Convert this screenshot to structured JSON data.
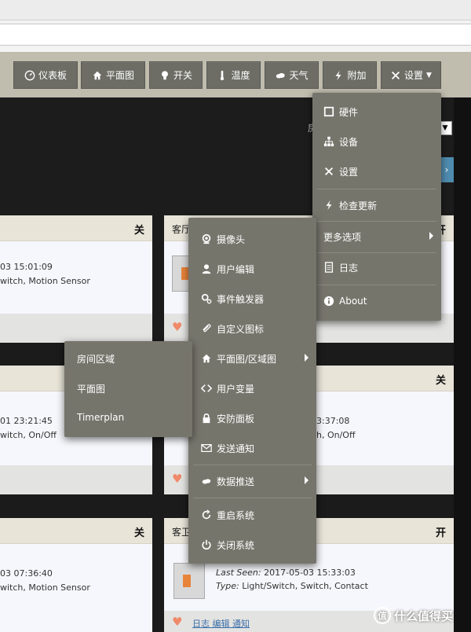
{
  "navbar": {
    "buttons": [
      {
        "label": "仪表板",
        "icon": "dashboard-icon"
      },
      {
        "label": "平面图",
        "icon": "home-icon"
      },
      {
        "label": "开关",
        "icon": "bulb-icon"
      },
      {
        "label": "温度",
        "icon": "thermometer-icon"
      },
      {
        "label": "天气",
        "icon": "cloud-icon"
      },
      {
        "label": "附加",
        "icon": "bolt-icon"
      },
      {
        "label": "设置",
        "icon": "wrench-icon"
      }
    ]
  },
  "header": {
    "partial_label": "房",
    "select_arrow": "▼",
    "next_arrow": "›"
  },
  "settings_menu": {
    "items": [
      {
        "label": "硬件",
        "icon": "hardware-icon"
      },
      {
        "label": "设备",
        "icon": "sitemap-icon"
      },
      {
        "label": "设置",
        "icon": "wrench-icon"
      },
      {
        "label": "检查更新",
        "icon": "bolt-icon"
      },
      {
        "label": "更多选项",
        "icon": ""
      },
      {
        "label": "日志",
        "icon": "log-icon"
      },
      {
        "label": "About",
        "icon": "info-icon"
      }
    ]
  },
  "more_menu": {
    "items": [
      {
        "label": "摄像头",
        "icon": "camera-icon"
      },
      {
        "label": "用户编辑",
        "icon": "user-icon"
      },
      {
        "label": "事件触发器",
        "icon": "gears-icon"
      },
      {
        "label": "自定义图标",
        "icon": "paperclip-icon"
      },
      {
        "label": "平面图/区域图",
        "icon": "home-icon"
      },
      {
        "label": "用户变量",
        "icon": "code-icon"
      },
      {
        "label": "安防面板",
        "icon": "lock-icon"
      },
      {
        "label": "发送通知",
        "icon": "envelope-icon"
      },
      {
        "label": "数据推送",
        "icon": "cloud-arrow-icon"
      },
      {
        "label": "重启系统",
        "icon": "refresh-icon"
      },
      {
        "label": "关闭系统",
        "icon": "power-icon"
      }
    ]
  },
  "plan_menu": {
    "items": [
      {
        "label": "房间区域"
      },
      {
        "label": "平面图"
      },
      {
        "label": "Timerplan"
      }
    ]
  },
  "cards": {
    "left": [
      {
        "state": "关",
        "time": "03 15:01:09",
        "type": "witch, Motion Sensor"
      },
      {
        "state": "",
        "time": "01 23:21:45",
        "type": "witch, On/Off"
      },
      {
        "state": "关",
        "time": "03 07:36:40",
        "type": "witch, Motion Sensor"
      }
    ],
    "right": [
      {
        "name": "客厅",
        "state": "开"
      },
      {
        "name": "",
        "state": "关",
        "time": "3:37:08",
        "type": "h, On/Off"
      },
      {
        "name": "客卫",
        "state": "开",
        "last_seen_label": "Last Seen:",
        "last_seen": " 2017-05-03 15:33:03",
        "type_label": "Type:",
        "type": " Light/Switch, Switch, Contact",
        "links": "日志  编辑  通知"
      }
    ]
  },
  "watermark": {
    "logo": "值",
    "text": "什么值得买"
  }
}
